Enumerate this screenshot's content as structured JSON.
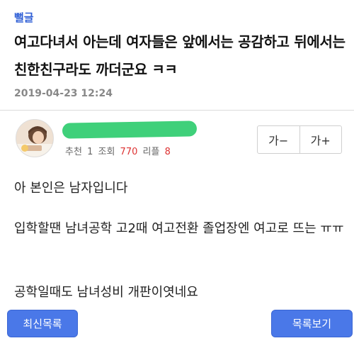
{
  "post": {
    "category": "뻘글",
    "title": "여고다녀서 아는데 여자들은 앞에서는 공감하고 뒤에서는 친한친구라도 까더군요 ㅋㅋ",
    "date": "2019-04-23 12:24"
  },
  "author": {
    "nickname_redacted": true,
    "recommend_label": "추천",
    "recommend_value": "1",
    "views_label": "조회",
    "views_value": "770",
    "replies_label": "리플",
    "replies_value": "8"
  },
  "font_controls": {
    "decrease": "가−",
    "increase": "가+"
  },
  "content": {
    "line1": "아 본인은 남자입니다",
    "line2": "입학할땐 남녀공학 고2때 여고전환 졸업장엔 여고로 뜨는 ㅠㅠ",
    "line3": "공학일때도 남녀성비 개판이엿네요"
  },
  "buttons": {
    "latest_list": "최신목록",
    "view_list": "목록보기"
  },
  "colors": {
    "accent": "#4a78e8",
    "category": "#2f5fd6",
    "redaction": "#3fd07a"
  }
}
